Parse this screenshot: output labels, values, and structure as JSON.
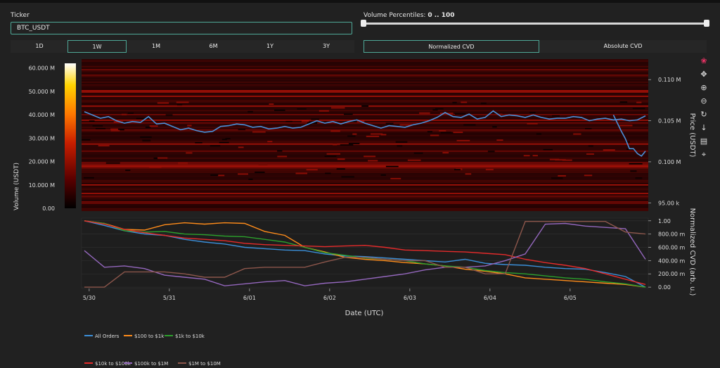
{
  "ticker": {
    "label": "Ticker",
    "value": "BTC_USDT"
  },
  "volume_percentiles": {
    "label": "Volume Percentiles: ",
    "value": "0 .. 100"
  },
  "timeframes": [
    {
      "label": "1D",
      "active": false
    },
    {
      "label": "1W",
      "active": true
    },
    {
      "label": "1M",
      "active": false
    },
    {
      "label": "6M",
      "active": false
    },
    {
      "label": "1Y",
      "active": false
    },
    {
      "label": "3Y",
      "active": false
    }
  ],
  "cvd_modes": [
    {
      "label": "Normalized CVD",
      "active": true
    },
    {
      "label": "Absolute CVD",
      "active": false
    }
  ],
  "modebar_icons": [
    "plotly-logo-icon",
    "pan-icon",
    "zoom-in-icon",
    "zoom-out-icon",
    "reset-icon",
    "download-icon",
    "comment-icon",
    "crosshair-icon"
  ],
  "chart_data": {
    "type": "heatmap",
    "xlabel": "Date (UTC)",
    "x_ticks": [
      "5/30",
      "5/31",
      "6/01",
      "6/02",
      "6/03",
      "6/04",
      "6/05"
    ],
    "colorbar": {
      "title": "Volume (USDT)",
      "ticks": [
        "60.000 M",
        "50.000 M",
        "40.000 M",
        "30.000 M",
        "20.000 M",
        "10.000 M",
        "0.00"
      ],
      "range": [
        0,
        62000000
      ],
      "colorscale": [
        "#000000",
        "#5a0000",
        "#c81e00",
        "#ff7800",
        "#ffd400",
        "#ffffff"
      ]
    },
    "price_axis": {
      "title": "Price (USDT)",
      "ticks": [
        "0.110 M",
        "0.105 M",
        "0.100 M",
        "95.00 k"
      ],
      "tick_values": [
        110000,
        105000,
        100000,
        95000
      ],
      "range": [
        94000,
        112500
      ]
    },
    "price_series": {
      "color": "#4a90d9",
      "x": [
        0,
        0.1,
        0.2,
        0.3,
        0.4,
        0.5,
        0.6,
        0.7,
        0.8,
        0.9,
        1,
        1.1,
        1.2,
        1.3,
        1.4,
        1.5,
        1.6,
        1.7,
        1.8,
        1.9,
        2,
        2.1,
        2.2,
        2.3,
        2.4,
        2.5,
        2.6,
        2.7,
        2.8,
        2.9,
        3,
        3.1,
        3.2,
        3.3,
        3.4,
        3.5,
        3.6,
        3.7,
        3.8,
        3.9,
        4,
        4.1,
        4.2,
        4.3,
        4.4,
        4.5,
        4.6,
        4.7,
        4.8,
        4.9,
        5,
        5.1,
        5.2,
        5.3,
        5.4,
        5.5,
        5.6,
        5.7,
        5.8,
        5.9,
        6,
        6.1,
        6.2,
        6.3,
        6.4,
        6.5,
        6.6,
        6.7,
        6.8,
        6.9,
        7.0
      ],
      "y": [
        106100,
        105700,
        105300,
        105500,
        105000,
        104700,
        104900,
        104800,
        105500,
        104600,
        104700,
        104300,
        103900,
        104100,
        103800,
        103600,
        103700,
        104300,
        104400,
        104600,
        104500,
        104200,
        104300,
        104000,
        104100,
        104300,
        104100,
        104200,
        104600,
        105000,
        104700,
        104900,
        104600,
        104900,
        105100,
        104700,
        104400,
        104100,
        104400,
        104300,
        104200,
        104500,
        104700,
        105000,
        105400,
        106000,
        105500,
        105400,
        105800,
        105200,
        105400,
        106200,
        105500,
        105700,
        105600,
        105400,
        105700,
        105400,
        105200,
        105300,
        105300,
        105500,
        105400,
        105000,
        105200,
        105300,
        105100,
        105200,
        105000,
        105100,
        105600
      ],
      "x2": [
        6.6,
        6.7,
        6.75,
        6.8,
        6.85,
        6.9,
        6.95,
        7.0
      ],
      "y2": [
        105700,
        103700,
        102800,
        101600,
        101600,
        101000,
        100700,
        101300
      ]
    },
    "cvd_axis": {
      "title": "Normalized CVD (arb. u.)",
      "ticks": [
        "1.00",
        "800.00 m",
        "600.00 m",
        "400.00 m",
        "200.00 m",
        "0.00"
      ],
      "tick_values": [
        1.0,
        0.8,
        0.6,
        0.4,
        0.2,
        0.0
      ],
      "range": [
        -0.02,
        1.04
      ]
    },
    "cvd_x": [
      0,
      0.25,
      0.5,
      0.75,
      1,
      1.25,
      1.5,
      1.75,
      2,
      2.25,
      2.5,
      2.75,
      3,
      3.25,
      3.5,
      3.75,
      4,
      4.25,
      4.5,
      4.75,
      5,
      5.25,
      5.5,
      5.75,
      6,
      6.25,
      6.5,
      6.75,
      7.0
    ],
    "series": [
      {
        "name": "All Orders",
        "color": "#3b8fd9",
        "values": [
          1.0,
          0.93,
          0.85,
          0.8,
          0.78,
          0.72,
          0.68,
          0.65,
          0.6,
          0.58,
          0.56,
          0.55,
          0.5,
          0.47,
          0.46,
          0.44,
          0.42,
          0.4,
          0.38,
          0.42,
          0.36,
          0.34,
          0.33,
          0.3,
          0.28,
          0.27,
          0.22,
          0.16,
          0.0
        ]
      },
      {
        "name": "$100 to $1k",
        "color": "#ff8c1a",
        "values": [
          1.0,
          0.96,
          0.87,
          0.86,
          0.94,
          0.97,
          0.95,
          0.97,
          0.96,
          0.84,
          0.78,
          0.6,
          0.53,
          0.45,
          0.42,
          0.4,
          0.37,
          0.35,
          0.32,
          0.27,
          0.24,
          0.2,
          0.14,
          0.12,
          0.1,
          0.08,
          0.06,
          0.04,
          0.0
        ]
      },
      {
        "name": "$1k to $10k",
        "color": "#2ca02c",
        "values": [
          1.0,
          0.96,
          0.85,
          0.83,
          0.84,
          0.8,
          0.79,
          0.77,
          0.76,
          0.72,
          0.68,
          0.6,
          0.52,
          0.48,
          0.44,
          0.42,
          0.4,
          0.35,
          0.32,
          0.3,
          0.25,
          0.22,
          0.2,
          0.17,
          0.14,
          0.12,
          0.08,
          0.05,
          0.0
        ]
      },
      {
        "name": "$10k to $100k",
        "color": "#e62b2b",
        "values": [
          1.0,
          0.95,
          0.87,
          0.82,
          0.78,
          0.74,
          0.72,
          0.7,
          0.66,
          0.64,
          0.63,
          0.62,
          0.61,
          0.62,
          0.63,
          0.6,
          0.56,
          0.55,
          0.54,
          0.53,
          0.51,
          0.49,
          0.42,
          0.37,
          0.33,
          0.28,
          0.2,
          0.12,
          0.04
        ]
      },
      {
        "name": "$100k to $1M",
        "color": "#9467bd",
        "values": [
          0.55,
          0.3,
          0.32,
          0.28,
          0.18,
          0.15,
          0.12,
          0.02,
          0.05,
          0.08,
          0.1,
          0.02,
          0.06,
          0.08,
          0.12,
          0.16,
          0.2,
          0.26,
          0.3,
          0.3,
          0.32,
          0.4,
          0.5,
          0.95,
          0.96,
          0.92,
          0.9,
          0.88,
          0.42
        ]
      },
      {
        "name": "$1M to $10M",
        "color": "#8c564b",
        "values": [
          0.0,
          0.0,
          0.23,
          0.23,
          0.23,
          0.2,
          0.15,
          0.15,
          0.28,
          0.3,
          0.3,
          0.3,
          0.38,
          0.45,
          0.45,
          0.42,
          0.4,
          0.4,
          0.3,
          0.3,
          0.2,
          0.2,
          0.99,
          0.99,
          0.99,
          0.99,
          0.99,
          0.83,
          0.8
        ]
      }
    ]
  }
}
